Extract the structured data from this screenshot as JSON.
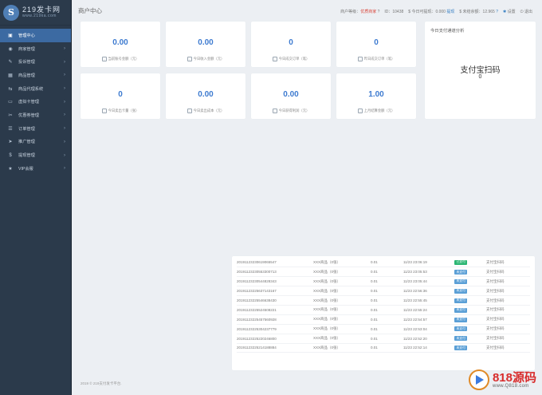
{
  "brand": {
    "name": "219发卡网",
    "url": "www.219ka.com"
  },
  "sidebar": {
    "items": [
      {
        "label": "管理中心",
        "icon": "dashboard-icon",
        "active": true
      },
      {
        "label": "商家管理",
        "icon": "user-icon"
      },
      {
        "label": "投诉管理",
        "icon": "complaint-icon"
      },
      {
        "label": "商品管理",
        "icon": "package-icon"
      },
      {
        "label": "商品代理系统",
        "icon": "share-icon"
      },
      {
        "label": "虚拟卡管理",
        "icon": "card-icon"
      },
      {
        "label": "优惠券管理",
        "icon": "coupon-icon"
      },
      {
        "label": "订单管理",
        "icon": "order-icon"
      },
      {
        "label": "推广管理",
        "icon": "promote-icon"
      },
      {
        "label": "提现管理",
        "icon": "dollar-icon"
      },
      {
        "label": "VIP会服",
        "icon": "vip-icon"
      }
    ]
  },
  "header": {
    "title": "商户中心",
    "merchant_level_label": "商户等级：",
    "merchant_level": "优质商家",
    "id_text": "ID：10438",
    "withdraw_text": "$ 今日可提现：0.000",
    "withdraw_link": "提现",
    "unsettled_text": "$ 未结余额：12.965",
    "settings": "设置",
    "logout": "退出"
  },
  "stats": [
    {
      "value": "0.00",
      "label": "当前账号金额（元）"
    },
    {
      "value": "0.00",
      "label": "今日收入金额（元）"
    },
    {
      "value": "0",
      "label": "今日成交订单（笔）"
    },
    {
      "value": "0",
      "label": "昨日成交订单（笔）"
    },
    {
      "value": "0",
      "label": "今日卖出卡量（张）"
    },
    {
      "value": "0.00",
      "label": "今日卖出成本（元）"
    },
    {
      "value": "0.00",
      "label": "今日获得利润（元）"
    },
    {
      "value": "1.00",
      "label": "上月结算金额（元）"
    }
  ],
  "analysis": {
    "heading": "今日支付通道分析",
    "channel": "支付宝扫码",
    "count": "0"
  },
  "orders": {
    "rows": [
      {
        "id": "20191123230619065547",
        "product": "XXX商品（0张）",
        "amount": "0.01",
        "time": "11/23 23:06:19",
        "status": "已支付",
        "paid": true,
        "channel": "支付宝扫码"
      },
      {
        "id": "20191123230553300713",
        "product": "XXX商品（0张）",
        "amount": "0.01",
        "time": "11/23 23:05:53",
        "status": "未支付",
        "paid": false,
        "channel": "支付宝扫码"
      },
      {
        "id": "20191123230544828343",
        "product": "XXX商品（0张）",
        "amount": "0.01",
        "time": "11/23 23:05:44",
        "status": "未支付",
        "paid": false,
        "channel": "支付宝扫码"
      },
      {
        "id": "20191123225637143167",
        "product": "XXX商品（0张）",
        "amount": "0.01",
        "time": "11/23 22:56:36",
        "status": "未支付",
        "paid": false,
        "channel": "支付宝扫码"
      },
      {
        "id": "20191123225546638430",
        "product": "XXX商品（0张）",
        "amount": "0.01",
        "time": "11/23 22:55:45",
        "status": "未支付",
        "paid": false,
        "channel": "支付宝扫码"
      },
      {
        "id": "20191123225524508221",
        "product": "XXX商品（0张）",
        "amount": "0.01",
        "time": "11/23 22:55:24",
        "status": "未支付",
        "paid": false,
        "channel": "支付宝扫码"
      },
      {
        "id": "20191123225457560928",
        "product": "XXX商品（0张）",
        "amount": "0.01",
        "time": "11/23 22:54:57",
        "status": "未支付",
        "paid": false,
        "channel": "支付宝扫码"
      },
      {
        "id": "20191123225304237779",
        "product": "XXX商品（0张）",
        "amount": "0.01",
        "time": "11/23 22:53:04",
        "status": "未支付",
        "paid": false,
        "channel": "支付宝扫码"
      },
      {
        "id": "20191123225220246800",
        "product": "XXX商品（0张）",
        "amount": "0.01",
        "time": "11/23 22:52:20",
        "status": "未支付",
        "paid": false,
        "channel": "支付宝扫码"
      },
      {
        "id": "20191123225214188884",
        "product": "XXX商品（0张）",
        "amount": "0.01",
        "time": "11/23 22:52:14",
        "status": "未支付",
        "paid": false,
        "channel": "支付宝扫码"
      }
    ]
  },
  "footer": "2019 © 219支付发卡平台.",
  "watermark": {
    "brand": "818源码",
    "url": "www.Q818.com"
  }
}
